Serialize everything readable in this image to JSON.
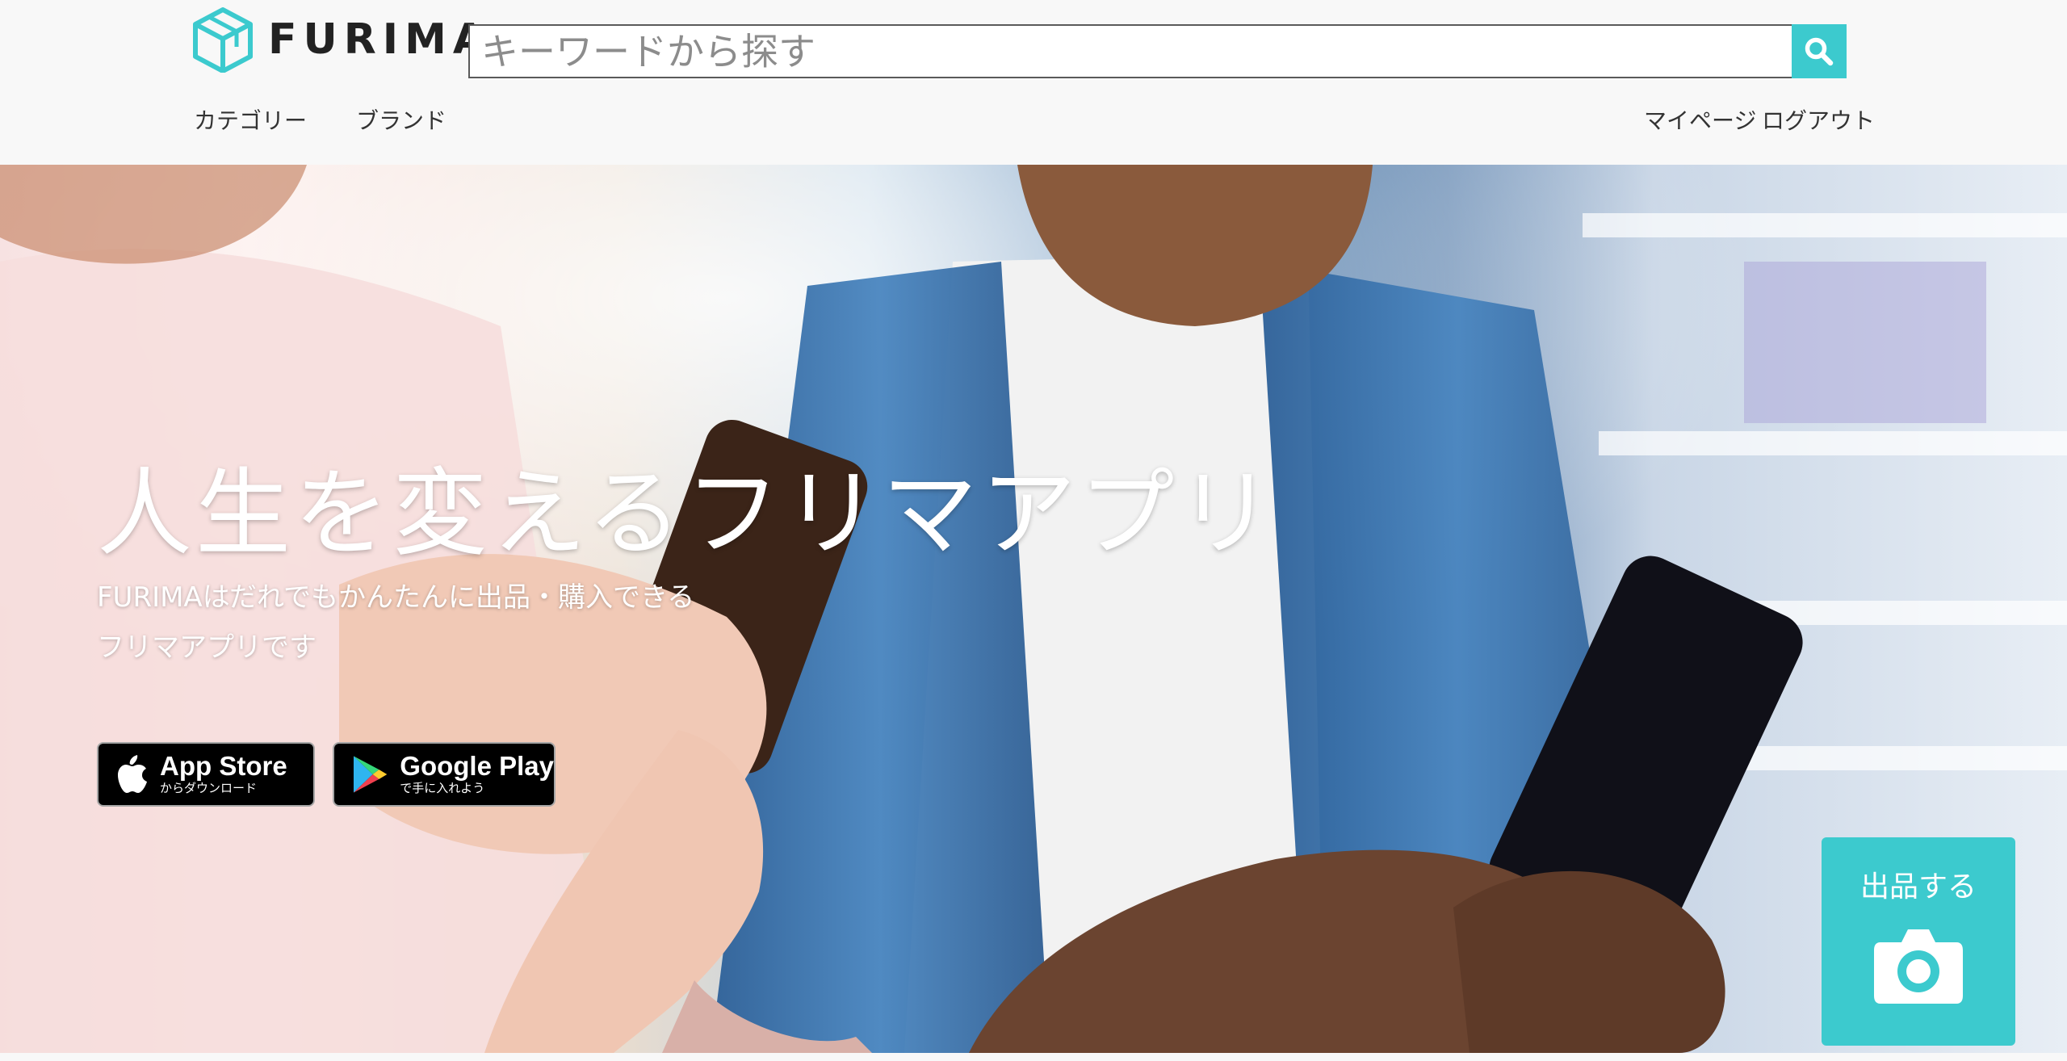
{
  "header": {
    "logo_text": "FURIMA",
    "search": {
      "placeholder": "キーワードから探す",
      "value": ""
    },
    "nav": {
      "category": "カテゴリー",
      "brand": "ブランド",
      "mypage": "マイページ",
      "logout": "ログアウト"
    }
  },
  "hero": {
    "title": "人生を変えるフリマアプリ",
    "subtitle_line1": "FURIMAはだれでもかんたんに出品・購入できる",
    "subtitle_line2": "フリマアプリです",
    "badges": {
      "appstore": {
        "main": "App Store",
        "sub": "からダウンロード"
      },
      "googleplay": {
        "main": "Google Play",
        "sub": "で手に入れよう"
      }
    }
  },
  "sell_button": {
    "label": "出品する"
  },
  "colors": {
    "accent": "#3ccace",
    "header_bg": "#f8f8f8"
  },
  "icons": {
    "logo": "cube-logo-icon",
    "search": "search-icon",
    "apple": "apple-icon",
    "play": "google-play-icon",
    "camera": "camera-icon"
  }
}
